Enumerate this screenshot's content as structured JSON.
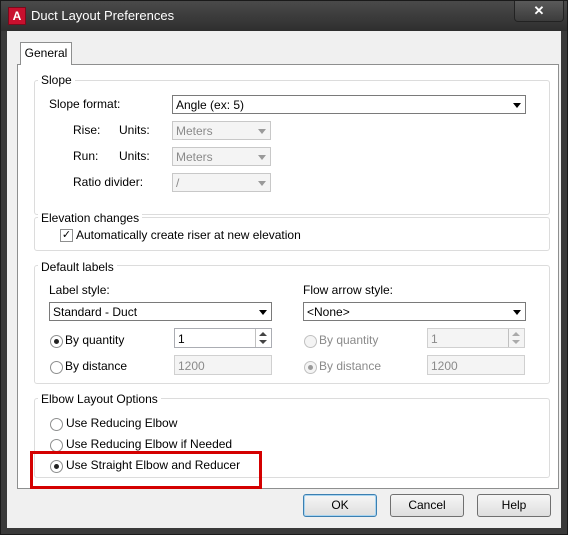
{
  "window": {
    "title": "Duct Layout Preferences",
    "close_glyph": "✕"
  },
  "tabs": [
    {
      "label": "General"
    }
  ],
  "slope": {
    "group_label": "Slope",
    "format_label": "Slope format:",
    "format_value": "Angle (ex: 5)",
    "rise_label": "Rise:",
    "rise_units_label": "Units:",
    "rise_units_value": "Meters",
    "run_label": "Run:",
    "run_units_label": "Units:",
    "run_units_value": "Meters",
    "ratio_label": "Ratio divider:",
    "ratio_value": "/"
  },
  "elevation": {
    "group_label": "Elevation changes",
    "auto_riser_label": "Automatically create riser at new elevation",
    "auto_riser_checked": true,
    "check_glyph": "✓"
  },
  "labels": {
    "group_label": "Default labels",
    "label_style_label": "Label style:",
    "label_style_value": "Standard - Duct",
    "by_quantity_label": "By quantity",
    "quantity_value": "1",
    "by_distance_label": "By distance",
    "distance_value": "1200",
    "flow_style_label": "Flow arrow style:",
    "flow_style_value": "<None>",
    "flow_by_quantity_label": "By quantity",
    "flow_quantity_value": "1",
    "flow_by_distance_label": "By distance",
    "flow_distance_value": "1200"
  },
  "elbow": {
    "group_label": "Elbow Layout Options",
    "opt1": "Use Reducing Elbow",
    "opt2": "Use Reducing Elbow if Needed",
    "opt3": "Use Straight Elbow and Reducer"
  },
  "buttons": {
    "ok": "OK",
    "cancel": "Cancel",
    "help": "Help"
  },
  "colors": {
    "highlight": "#d40000",
    "title_bar": "#3a3a3a",
    "app_icon": "#c8102e"
  }
}
